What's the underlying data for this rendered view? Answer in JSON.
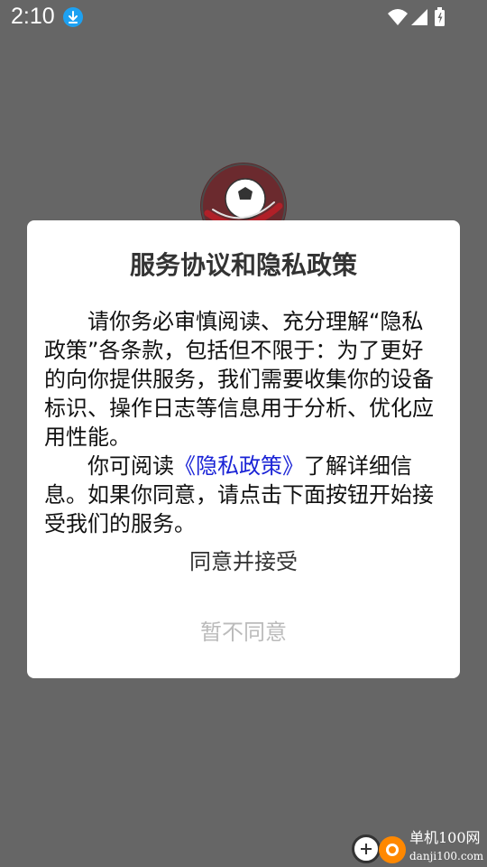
{
  "status_bar": {
    "time": "2:10",
    "icons": [
      "download-icon",
      "wifi-icon",
      "signal-icon",
      "battery-icon"
    ]
  },
  "dialog": {
    "title": "服务协议和隐私政策",
    "paragraph1": "请你务必审慎阅读、充分理解“隐私政策”各条款，包括但不限于：为了更好的向你提供服务，我们需要收集你的设备标识、操作日志等信息用于分析、优化应用性能。",
    "paragraph2_before": "你可阅读",
    "privacy_link": "《隐私政策》",
    "paragraph2_after": "了解详细信息。如果你同意，请点击下面按钮开始接受我们的服务。",
    "agree_label": "同意并接受",
    "disagree_label": "暂不同意"
  },
  "colors": {
    "overlay": "#666666",
    "link": "#1a23d6",
    "disabled_text": "#bbbbbb"
  },
  "watermark": {
    "name": "单机100网",
    "url": "danji100.com"
  }
}
